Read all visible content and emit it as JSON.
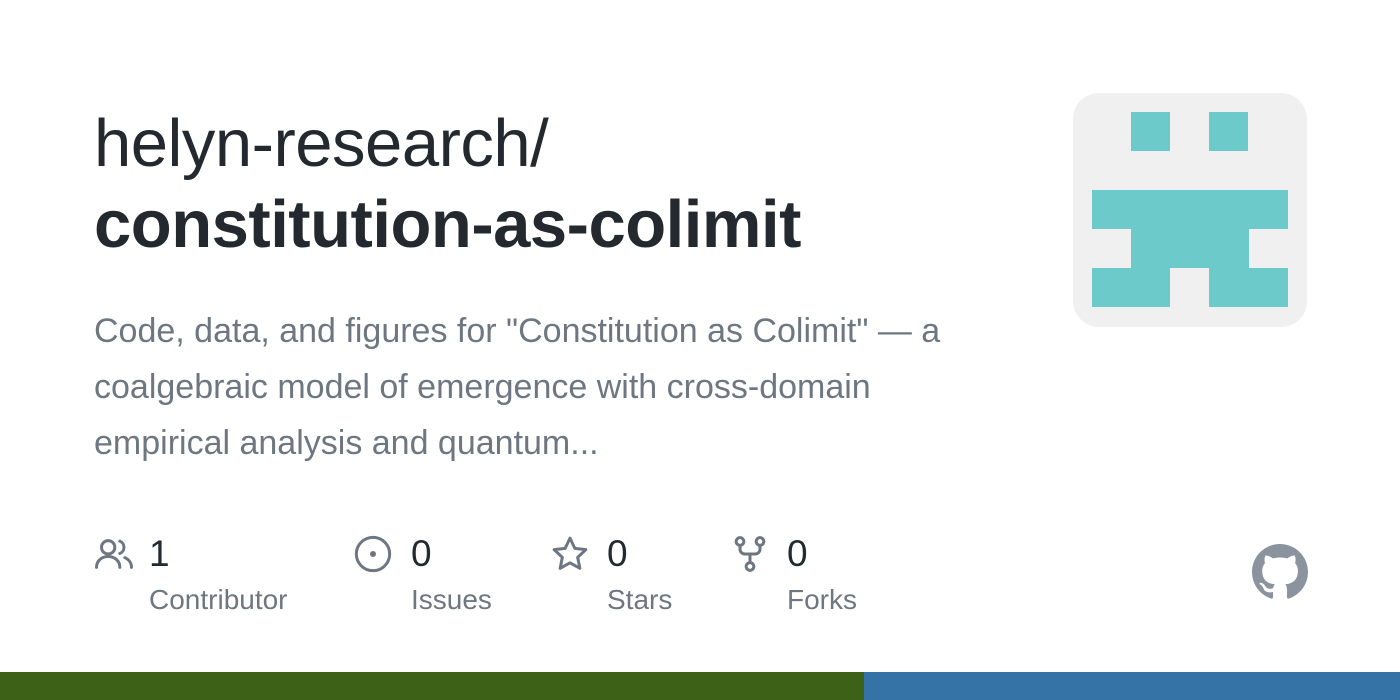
{
  "repo": {
    "owner": "helyn-research/",
    "name": "constitution-as-colimit",
    "description": "Code, data, and figures for \"Constitution as Colimit\" — a coalgebraic model of emergence with cross-domain empirical analysis and quantum..."
  },
  "stats": {
    "contributors": {
      "value": "1",
      "label": "Contributor",
      "icon": "people-icon"
    },
    "issues": {
      "value": "0",
      "label": "Issues",
      "icon": "issue-opened-icon"
    },
    "stars": {
      "value": "0",
      "label": "Stars",
      "icon": "star-icon"
    },
    "forks": {
      "value": "0",
      "label": "Forks",
      "icon": "repo-forked-icon"
    }
  },
  "avatar": {
    "icon": "identicon",
    "color": "#6ccbca",
    "background": "#f0f0f0"
  },
  "brand": {
    "icon": "github-mark-icon",
    "color": "#8b949e"
  },
  "languages": [
    {
      "color": "#3d6117",
      "share": 0.617
    },
    {
      "color": "#3572a5",
      "share": 0.383
    }
  ]
}
